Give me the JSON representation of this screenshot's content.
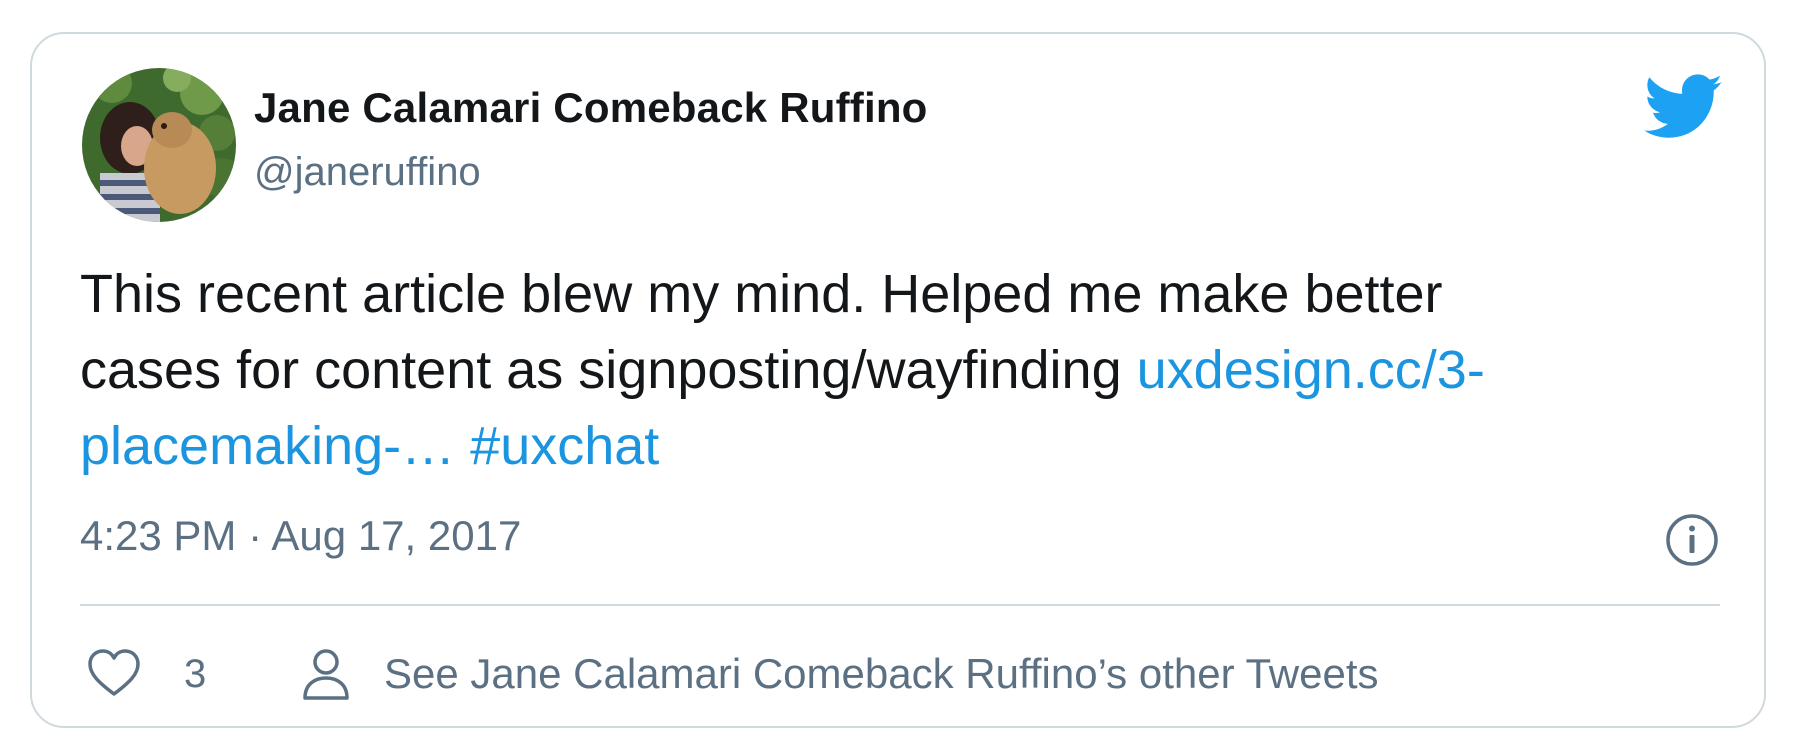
{
  "author": {
    "name": "Jane Calamari Comeback Ruffino",
    "handle": "@janeruffino"
  },
  "tweet": {
    "text_line1": "This recent article blew my mind. Helped me make better",
    "text_line2": "cases for content as signposting/wayfinding ",
    "link": "uxdesign.cc/3-placemaking-…",
    "hashtag": "#uxchat",
    "timestamp": "4:23 PM · Aug 17, 2017"
  },
  "actions": {
    "like_count": "3",
    "other_tweets_label": "See Jane Calamari Comeback Ruffino’s other Tweets"
  },
  "icons": {
    "brand": "twitter-bird-icon",
    "info": "info-icon",
    "like": "heart-icon",
    "profile": "person-icon"
  },
  "colors": {
    "brand_blue": "#1da1f2",
    "link_blue": "#1b95e0",
    "secondary_text": "#5b7083",
    "border": "#cfd9de"
  }
}
